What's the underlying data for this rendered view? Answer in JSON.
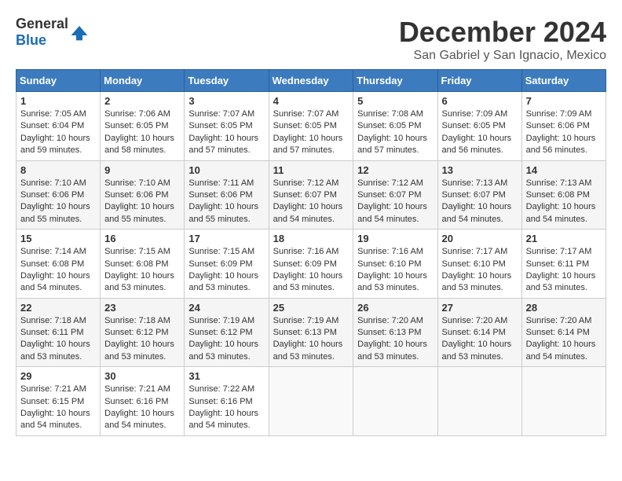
{
  "header": {
    "logo_general": "General",
    "logo_blue": "Blue",
    "month_title": "December 2024",
    "location": "San Gabriel y San Ignacio, Mexico"
  },
  "days_of_week": [
    "Sunday",
    "Monday",
    "Tuesday",
    "Wednesday",
    "Thursday",
    "Friday",
    "Saturday"
  ],
  "weeks": [
    [
      {
        "day": "1",
        "sunrise": "7:05 AM",
        "sunset": "6:04 PM",
        "daylight": "10 hours and 59 minutes."
      },
      {
        "day": "2",
        "sunrise": "7:06 AM",
        "sunset": "6:05 PM",
        "daylight": "10 hours and 58 minutes."
      },
      {
        "day": "3",
        "sunrise": "7:07 AM",
        "sunset": "6:05 PM",
        "daylight": "10 hours and 57 minutes."
      },
      {
        "day": "4",
        "sunrise": "7:07 AM",
        "sunset": "6:05 PM",
        "daylight": "10 hours and 57 minutes."
      },
      {
        "day": "5",
        "sunrise": "7:08 AM",
        "sunset": "6:05 PM",
        "daylight": "10 hours and 57 minutes."
      },
      {
        "day": "6",
        "sunrise": "7:09 AM",
        "sunset": "6:05 PM",
        "daylight": "10 hours and 56 minutes."
      },
      {
        "day": "7",
        "sunrise": "7:09 AM",
        "sunset": "6:06 PM",
        "daylight": "10 hours and 56 minutes."
      }
    ],
    [
      {
        "day": "8",
        "sunrise": "7:10 AM",
        "sunset": "6:06 PM",
        "daylight": "10 hours and 55 minutes."
      },
      {
        "day": "9",
        "sunrise": "7:10 AM",
        "sunset": "6:06 PM",
        "daylight": "10 hours and 55 minutes."
      },
      {
        "day": "10",
        "sunrise": "7:11 AM",
        "sunset": "6:06 PM",
        "daylight": "10 hours and 55 minutes."
      },
      {
        "day": "11",
        "sunrise": "7:12 AM",
        "sunset": "6:07 PM",
        "daylight": "10 hours and 54 minutes."
      },
      {
        "day": "12",
        "sunrise": "7:12 AM",
        "sunset": "6:07 PM",
        "daylight": "10 hours and 54 minutes."
      },
      {
        "day": "13",
        "sunrise": "7:13 AM",
        "sunset": "6:07 PM",
        "daylight": "10 hours and 54 minutes."
      },
      {
        "day": "14",
        "sunrise": "7:13 AM",
        "sunset": "6:08 PM",
        "daylight": "10 hours and 54 minutes."
      }
    ],
    [
      {
        "day": "15",
        "sunrise": "7:14 AM",
        "sunset": "6:08 PM",
        "daylight": "10 hours and 54 minutes."
      },
      {
        "day": "16",
        "sunrise": "7:15 AM",
        "sunset": "6:08 PM",
        "daylight": "10 hours and 53 minutes."
      },
      {
        "day": "17",
        "sunrise": "7:15 AM",
        "sunset": "6:09 PM",
        "daylight": "10 hours and 53 minutes."
      },
      {
        "day": "18",
        "sunrise": "7:16 AM",
        "sunset": "6:09 PM",
        "daylight": "10 hours and 53 minutes."
      },
      {
        "day": "19",
        "sunrise": "7:16 AM",
        "sunset": "6:10 PM",
        "daylight": "10 hours and 53 minutes."
      },
      {
        "day": "20",
        "sunrise": "7:17 AM",
        "sunset": "6:10 PM",
        "daylight": "10 hours and 53 minutes."
      },
      {
        "day": "21",
        "sunrise": "7:17 AM",
        "sunset": "6:11 PM",
        "daylight": "10 hours and 53 minutes."
      }
    ],
    [
      {
        "day": "22",
        "sunrise": "7:18 AM",
        "sunset": "6:11 PM",
        "daylight": "10 hours and 53 minutes."
      },
      {
        "day": "23",
        "sunrise": "7:18 AM",
        "sunset": "6:12 PM",
        "daylight": "10 hours and 53 minutes."
      },
      {
        "day": "24",
        "sunrise": "7:19 AM",
        "sunset": "6:12 PM",
        "daylight": "10 hours and 53 minutes."
      },
      {
        "day": "25",
        "sunrise": "7:19 AM",
        "sunset": "6:13 PM",
        "daylight": "10 hours and 53 minutes."
      },
      {
        "day": "26",
        "sunrise": "7:20 AM",
        "sunset": "6:13 PM",
        "daylight": "10 hours and 53 minutes."
      },
      {
        "day": "27",
        "sunrise": "7:20 AM",
        "sunset": "6:14 PM",
        "daylight": "10 hours and 53 minutes."
      },
      {
        "day": "28",
        "sunrise": "7:20 AM",
        "sunset": "6:14 PM",
        "daylight": "10 hours and 54 minutes."
      }
    ],
    [
      {
        "day": "29",
        "sunrise": "7:21 AM",
        "sunset": "6:15 PM",
        "daylight": "10 hours and 54 minutes."
      },
      {
        "day": "30",
        "sunrise": "7:21 AM",
        "sunset": "6:16 PM",
        "daylight": "10 hours and 54 minutes."
      },
      {
        "day": "31",
        "sunrise": "7:22 AM",
        "sunset": "6:16 PM",
        "daylight": "10 hours and 54 minutes."
      },
      null,
      null,
      null,
      null
    ]
  ]
}
